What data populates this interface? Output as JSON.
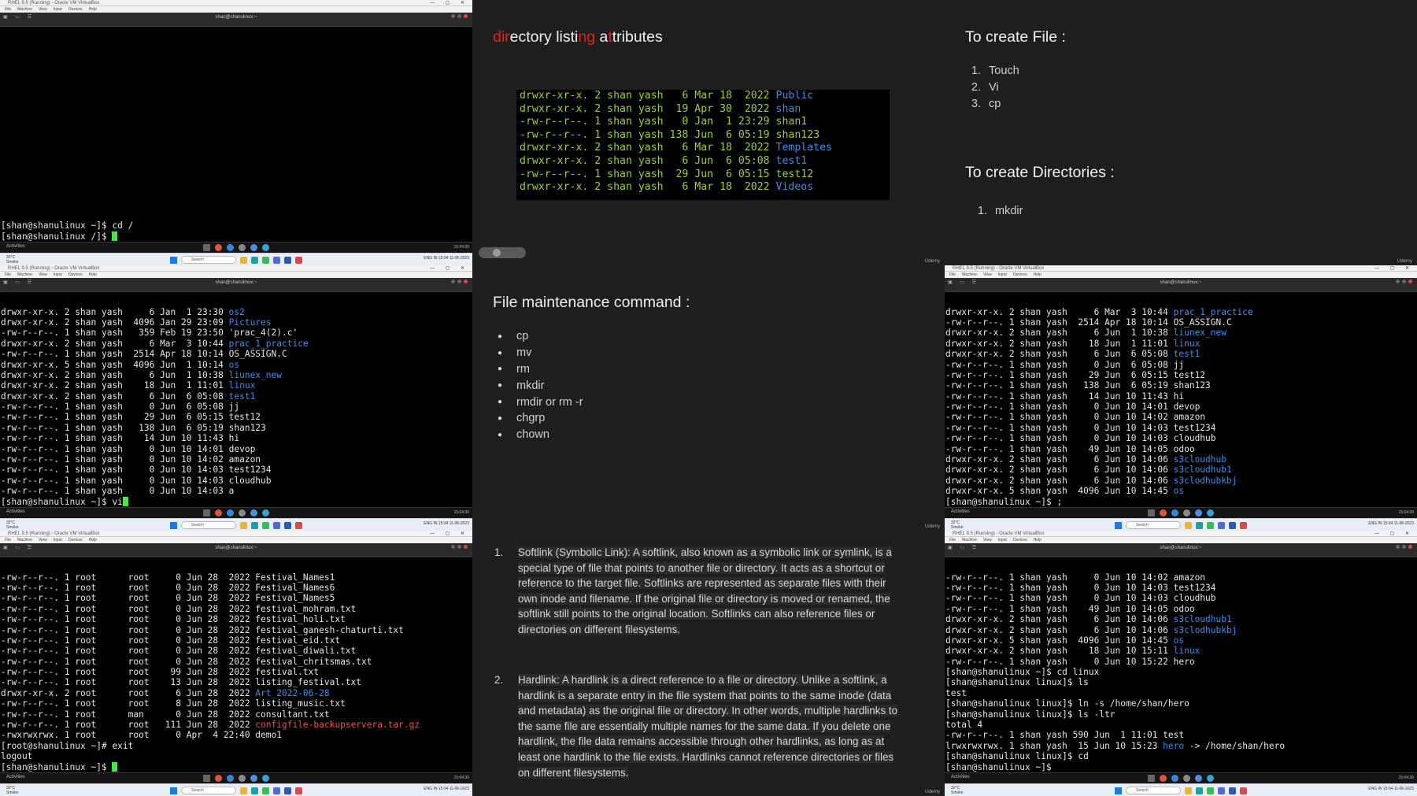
{
  "vm_titlebar": "RHEL 9.5 (Running) - Oracle VM VirtualBox",
  "vm_menu": [
    "File",
    "Machine",
    "View",
    "Input",
    "Devices",
    "Help"
  ],
  "guest_title": "shan@shanulinux:~",
  "gnome": {
    "activities": "Activities",
    "status": "15:04:30"
  },
  "win_taskbar": {
    "weather_temp": "32°C",
    "weather_desc": "Smoke",
    "search": "Search",
    "lang": "ENG IN",
    "time": "15:04",
    "date": "11-06-2023"
  },
  "term1": {
    "lines": [
      [
        {
          "t": "[shan@shanulinux ~]$ cd /"
        }
      ],
      [
        {
          "t": "[shan@shanulinux /]$ "
        },
        {
          "cursor": true
        }
      ]
    ]
  },
  "term2": {
    "lines": [
      [
        {
          "t": "drwxr-xr-x. 2 shan yash     6 Jan  1 23:30 "
        },
        {
          "t": "os2",
          "c": "b"
        }
      ],
      [
        {
          "t": "drwxr-xr-x. 2 shan yash  4096 Jan 29 23:09 "
        },
        {
          "t": "Pictures",
          "c": "b"
        }
      ],
      [
        {
          "t": "-rw-r--r--. 1 shan yash   359 Feb 19 23:50 'prac_4(2).c'"
        }
      ],
      [
        {
          "t": "drwxr-xr-x. 2 shan yash     6 Mar  3 10:44 "
        },
        {
          "t": "prac_1_practice",
          "c": "b"
        }
      ],
      [
        {
          "t": "-rw-r--r--. 1 shan yash  2514 Apr 18 10:14 OS_ASSIGN.C"
        }
      ],
      [
        {
          "t": "drwxr-xr-x. 5 shan yash  4096 Jun  1 10:14 "
        },
        {
          "t": "os",
          "c": "b"
        }
      ],
      [
        {
          "t": "drwxr-xr-x. 2 shan yash     6 Jun  1 10:38 "
        },
        {
          "t": "liunex_new",
          "c": "b"
        }
      ],
      [
        {
          "t": "drwxr-xr-x. 2 shan yash    18 Jun  1 11:01 "
        },
        {
          "t": "linux",
          "c": "b"
        }
      ],
      [
        {
          "t": "drwxr-xr-x. 2 shan yash     6 Jun  6 05:08 "
        },
        {
          "t": "test1",
          "c": "b"
        }
      ],
      [
        {
          "t": "-rw-r--r--. 1 shan yash     0 Jun  6 05:08 jj"
        }
      ],
      [
        {
          "t": "-rw-r--r--. 1 shan yash    29 Jun  6 05:15 test12"
        }
      ],
      [
        {
          "t": "-rw-r--r--. 1 shan yash   138 Jun  6 05:19 shan123"
        }
      ],
      [
        {
          "t": "-rw-r--r--. 1 shan yash    14 Jun 10 11:43 hi"
        }
      ],
      [
        {
          "t": "-rw-r--r--. 1 shan yash     0 Jun 10 14:01 devop"
        }
      ],
      [
        {
          "t": "-rw-r--r--. 1 shan yash     0 Jun 10 14:02 amazon"
        }
      ],
      [
        {
          "t": "-rw-r--r--. 1 shan yash     0 Jun 10 14:03 test1234"
        }
      ],
      [
        {
          "t": "-rw-r--r--. 1 shan yash     0 Jun 10 14:03 cloudhub"
        }
      ],
      [
        {
          "t": "-rw-r--r--. 1 shan yash     0 Jun 10 14:03 a"
        }
      ],
      [
        {
          "t": "[shan@shanulinux ~]$ vi"
        },
        {
          "cursor": true
        }
      ]
    ]
  },
  "term3": {
    "lines": [
      [
        {
          "t": "-rw-r--r--. 1 root      root     0 Jun 28  2022 Festival_Names1"
        }
      ],
      [
        {
          "t": "-rw-r--r--. 1 root      root     0 Jun 28  2022 Festival_Names6"
        }
      ],
      [
        {
          "t": "-rw-r--r--. 1 root      root     0 Jun 28  2022 Festival_Names5"
        }
      ],
      [
        {
          "t": "-rw-r--r--. 1 root      root     0 Jun 28  2022 festival_mohram.txt"
        }
      ],
      [
        {
          "t": "-rw-r--r--. 1 root      root     0 Jun 28  2022 festival_holi.txt"
        }
      ],
      [
        {
          "t": "-rw-r--r--. 1 root      root     0 Jun 28  2022 festival_ganesh-chaturti.txt"
        }
      ],
      [
        {
          "t": "-rw-r--r--. 1 root      root     0 Jun 28  2022 festival_eid.txt"
        }
      ],
      [
        {
          "t": "-rw-r--r--. 1 root      root     0 Jun 28  2022 festival_diwali.txt"
        }
      ],
      [
        {
          "t": "-rw-r--r--. 1 root      root     0 Jun 28  2022 festival_chritsmas.txt"
        }
      ],
      [
        {
          "t": "-rw-r--r--. 1 root      root    99 Jun 28  2022 festival.txt"
        }
      ],
      [
        {
          "t": "-rw-r--r--. 1 root      root    13 Jun 28  2022 listing_festival.txt"
        }
      ],
      [
        {
          "t": "drwxr-xr-x. 2 root      root     6 Jun 28  2022 "
        },
        {
          "t": "Art_2022-06-28",
          "c": "b"
        }
      ],
      [
        {
          "t": "-rw-r--r--. 1 root      root     8 Jun 28  2022 listing_music.txt"
        }
      ],
      [
        {
          "t": "-rw-r--r--. 1 root      man      0 Jun 28  2022 consultant.txt"
        }
      ],
      [
        {
          "t": "-rw-r--r--. 1 root      root   111 Jun 28  2022 "
        },
        {
          "t": "configfile-backupservera.tar.gz",
          "c": "r"
        }
      ],
      [
        {
          "t": "-rwxrwxrwx. 1 root      root     0 Apr  4 22:40 demo1"
        }
      ],
      [
        {
          "t": "[root@shanulinux ~]# exit"
        }
      ],
      [
        {
          "t": "logout"
        }
      ],
      [
        {
          "t": "[shan@shanulinux ~]$ "
        },
        {
          "cursor": true
        }
      ]
    ]
  },
  "term4": {
    "lines": [
      [
        {
          "t": "drwxr-xr-x. 2 shan yash     6 Mar  3 10:44 "
        },
        {
          "t": "prac_1_practice",
          "c": "b"
        }
      ],
      [
        {
          "t": "-rw-r--r--. 1 shan yash  2514 Apr 18 10:14 OS_ASSIGN.C"
        }
      ],
      [
        {
          "t": "drwxr-xr-x. 2 shan yash     6 Jun  1 10:38 "
        },
        {
          "t": "liunex_new",
          "c": "b"
        }
      ],
      [
        {
          "t": "drwxr-xr-x. 2 shan yash    18 Jun  1 11:01 "
        },
        {
          "t": "linux",
          "c": "b"
        }
      ],
      [
        {
          "t": "drwxr-xr-x. 2 shan yash     6 Jun  6 05:08 "
        },
        {
          "t": "test1",
          "c": "b"
        }
      ],
      [
        {
          "t": "-rw-r--r--. 1 shan yash     0 Jun  6 05:08 jj"
        }
      ],
      [
        {
          "t": "-rw-r--r--. 1 shan yash    29 Jun  6 05:15 test12"
        }
      ],
      [
        {
          "t": "-rw-r--r--. 1 shan yash   138 Jun  6 05:19 shan123"
        }
      ],
      [
        {
          "t": "-rw-r--r--. 1 shan yash    14 Jun 10 11:43 hi"
        }
      ],
      [
        {
          "t": "-rw-r--r--. 1 shan yash     0 Jun 10 14:01 devop"
        }
      ],
      [
        {
          "t": "-rw-r--r--. 1 shan yash     0 Jun 10 14:02 amazon"
        }
      ],
      [
        {
          "t": "-rw-r--r--. 1 shan yash     0 Jun 10 14:03 test1234"
        }
      ],
      [
        {
          "t": "-rw-r--r--. 1 shan yash     0 Jun 10 14:03 cloudhub"
        }
      ],
      [
        {
          "t": "-rw-r--r--. 1 shan yash    49 Jun 10 14:05 odoo"
        }
      ],
      [
        {
          "t": "drwxr-xr-x. 2 shan yash     6 Jun 10 14:06 "
        },
        {
          "t": "s3cloudhub",
          "c": "b"
        }
      ],
      [
        {
          "t": "drwxr-xr-x. 2 shan yash     6 Jun 10 14:06 "
        },
        {
          "t": "s3cloudhub1",
          "c": "b"
        }
      ],
      [
        {
          "t": "drwxr-xr-x. 2 shan yash     6 Jun 10 14:06 "
        },
        {
          "t": "s3clodhubkbj",
          "c": "b"
        }
      ],
      [
        {
          "t": "drwxr-xr-x. 5 shan yash  4096 Jun 10 14:45 "
        },
        {
          "t": "os",
          "c": "b"
        }
      ],
      [
        {
          "t": "[shan@shanulinux ~]$ ;"
        }
      ]
    ]
  },
  "term5": {
    "lines": [
      [
        {
          "t": "-rw-r--r--. 1 shan yash     0 Jun 10 14:02 amazon"
        }
      ],
      [
        {
          "t": "-rw-r--r--. 1 shan yash     0 Jun 10 14:03 test1234"
        }
      ],
      [
        {
          "t": "-rw-r--r--. 1 shan yash     0 Jun 10 14:03 cloudhub"
        }
      ],
      [
        {
          "t": "-rw-r--r--. 1 shan yash    49 Jun 10 14:05 odoo"
        }
      ],
      [
        {
          "t": "drwxr-xr-x. 2 shan yash     6 Jun 10 14:06 "
        },
        {
          "t": "s3cloudhub1",
          "c": "b"
        }
      ],
      [
        {
          "t": "drwxr-xr-x. 2 shan yash     6 Jun 10 14:06 "
        },
        {
          "t": "s3clodhubkbj",
          "c": "b"
        }
      ],
      [
        {
          "t": "drwxr-xr-x. 5 shan yash  4096 Jun 10 14:45 "
        },
        {
          "t": "os",
          "c": "b"
        }
      ],
      [
        {
          "t": "drwxr-xr-x. 2 shan yash    18 Jun 10 15:11 "
        },
        {
          "t": "linux",
          "c": "b"
        }
      ],
      [
        {
          "t": "-rw-r--r--. 1 shan yash     0 Jun 10 15:22 hero"
        }
      ],
      [
        {
          "t": "[shan@shanulinux ~]$ cd linux"
        }
      ],
      [
        {
          "t": "[shan@shanulinux linux]$ ls"
        }
      ],
      [
        {
          "t": "test"
        }
      ],
      [
        {
          "t": "[shan@shanulinux linux]$ ln -s /home/shan/hero"
        }
      ],
      [
        {
          "t": "[shan@shanulinux linux]$ ls -ltr"
        }
      ],
      [
        {
          "t": "total 4"
        }
      ],
      [
        {
          "t": "-rw-r--r--. 1 shan yash 590 Jun  1 11:01 test"
        }
      ],
      [
        {
          "t": "lrwxrwxrwx. 1 shan yash  15 Jun 10 15:23 "
        },
        {
          "t": "hero",
          "c": "b"
        },
        {
          "t": " -> /home/shan/hero"
        }
      ],
      [
        {
          "t": "[shan@shanulinux linux]$ cd"
        }
      ],
      [
        {
          "t": "[shan@shanulinux ~]$ "
        }
      ]
    ]
  },
  "slide1": {
    "title_parts": [
      {
        "t": "dir",
        "c": "red"
      },
      {
        "t": "ectory listi"
      },
      {
        "t": "ng",
        "c": "red"
      },
      {
        "t": " a"
      },
      {
        "t": "t",
        "c": "red"
      },
      {
        "t": "tributes"
      }
    ],
    "shot_lines": [
      [
        {
          "t": "drwxr-xr-x. 2 shan yash   6 Mar 18  2022 "
        },
        {
          "t": "Public",
          "c": "b"
        }
      ],
      [
        {
          "t": "drwxr-xr-x. 2 shan yash  19 Apr 30  2022 "
        },
        {
          "t": "shan",
          "c": "b"
        }
      ],
      [
        {
          "t": "-rw-r--r--. 1 shan yash   0 Jan  1 23:29 shan1"
        }
      ],
      [
        {
          "t": "-rw-r--r--. 1 shan yash 138 Jun  6 05:19 shan123"
        }
      ],
      [
        {
          "t": "drwxr-xr-x. 2 shan yash   6 Mar 18  2022 "
        },
        {
          "t": "Templates",
          "c": "b"
        }
      ],
      [
        {
          "t": "drwxr-xr-x. 2 shan yash   6 Jun  6 05:08 "
        },
        {
          "t": "test1",
          "c": "b"
        }
      ],
      [
        {
          "t": "-rw-r--r--. 1 shan yash  29 Jun  6 05:15 test12"
        }
      ],
      [
        {
          "t": "drwxr-xr-x. 2 shan yash   6 Mar 18  2022 "
        },
        {
          "t": "Videos",
          "c": "b"
        }
      ]
    ]
  },
  "slide2": {
    "title1": "To create File :",
    "file_items": [
      "Touch",
      "Vi",
      "cp"
    ],
    "title2": "To create Directories :",
    "dir_items": [
      "mkdir"
    ]
  },
  "slide3": {
    "title": "File maintenance command :",
    "items": [
      "cp",
      "mv",
      "rm",
      "mkdir",
      "rmdir or rm -r",
      "chgrp",
      "chown"
    ]
  },
  "slide4": {
    "p1_lines": [
      "Softlink (Symbolic Link): A softlink, also known as a symbolic link or symlink, is a",
      "special type of file that points to another file or directory. It acts as a shortcut or",
      "reference to the target file. Softlinks are represented as separate files with their",
      "own inode and filename. If the original file or directory is moved or renamed, the",
      "softlink still points to the original location. Softlinks can also reference files or",
      "directories on different filesystems."
    ],
    "p2_lines": [
      "Hardlink: A hardlink is a direct reference to a file or directory. Unlike a softlink, a",
      "hardlink is a separate entry in the file system that points to the same inode (data",
      "and metadata) as the original file or directory. In other words, multiple hardlinks to",
      "the same file are essentially multiple names for the same data. If you delete one",
      "hardlink, the file data remains accessible through other hardlinks, as long as at",
      "least one hardlink to the file exists. Hardlinks cannot reference directories or files",
      "on different filesystems."
    ]
  },
  "udemy_label": "Udemy",
  "colors": {
    "term_green": "#9ad03d",
    "term_blue": "#3b8eea",
    "accent_red": "#e62020",
    "slide_bg": "#1e1e1e"
  }
}
